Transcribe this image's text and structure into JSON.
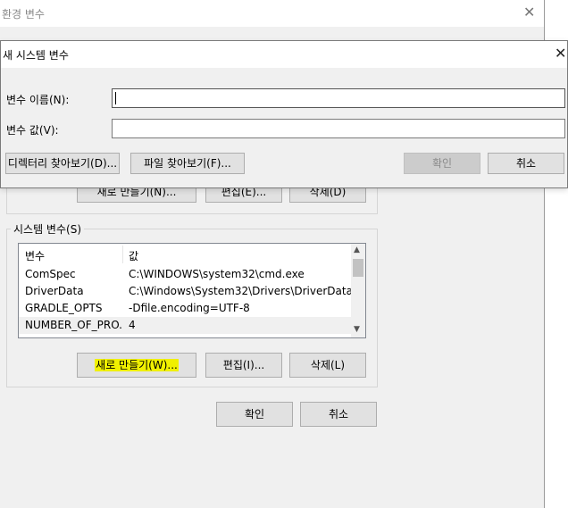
{
  "env_window": {
    "title": "환경 변수",
    "close_glyph": "✕",
    "user_buttons": {
      "new": "새로 만들기(N)...",
      "edit": "편집(E)...",
      "delete": "삭제(D)"
    },
    "system_group_label": "시스템 변수(S)",
    "system_list": {
      "columns": [
        "변수",
        "값"
      ],
      "rows": [
        {
          "name": "ComSpec",
          "value": "C:\\WINDOWS\\system32\\cmd.exe"
        },
        {
          "name": "DriverData",
          "value": "C:\\Windows\\System32\\Drivers\\DriverData"
        },
        {
          "name": "GRADLE_OPTS",
          "value": "-Dfile.encoding=UTF-8"
        },
        {
          "name": "NUMBER_OF_PRO...",
          "value": "4",
          "selected": true
        }
      ],
      "scroll_up_icon": "chevron-up-icon",
      "scroll_down_icon": "chevron-down-icon"
    },
    "system_buttons": {
      "new": "새로 만들기(W)...",
      "edit": "편집(I)...",
      "delete": "삭제(L)"
    },
    "ok": "확인",
    "cancel": "취소"
  },
  "dialog": {
    "title": "새 시스템 변수",
    "close_glyph": "✕",
    "name_label": "변수 이름(N):",
    "name_value": "",
    "value_label": "변수 값(V):",
    "value_value": "",
    "browse_dir": "디렉터리 찾아보기(D)...",
    "browse_file": "파일 찾아보기(F)...",
    "ok": "확인",
    "cancel": "취소"
  },
  "colors": {
    "highlight": "#f0f000",
    "window_bg": "#f0f0f0",
    "disabled_button": "#cccccc"
  }
}
